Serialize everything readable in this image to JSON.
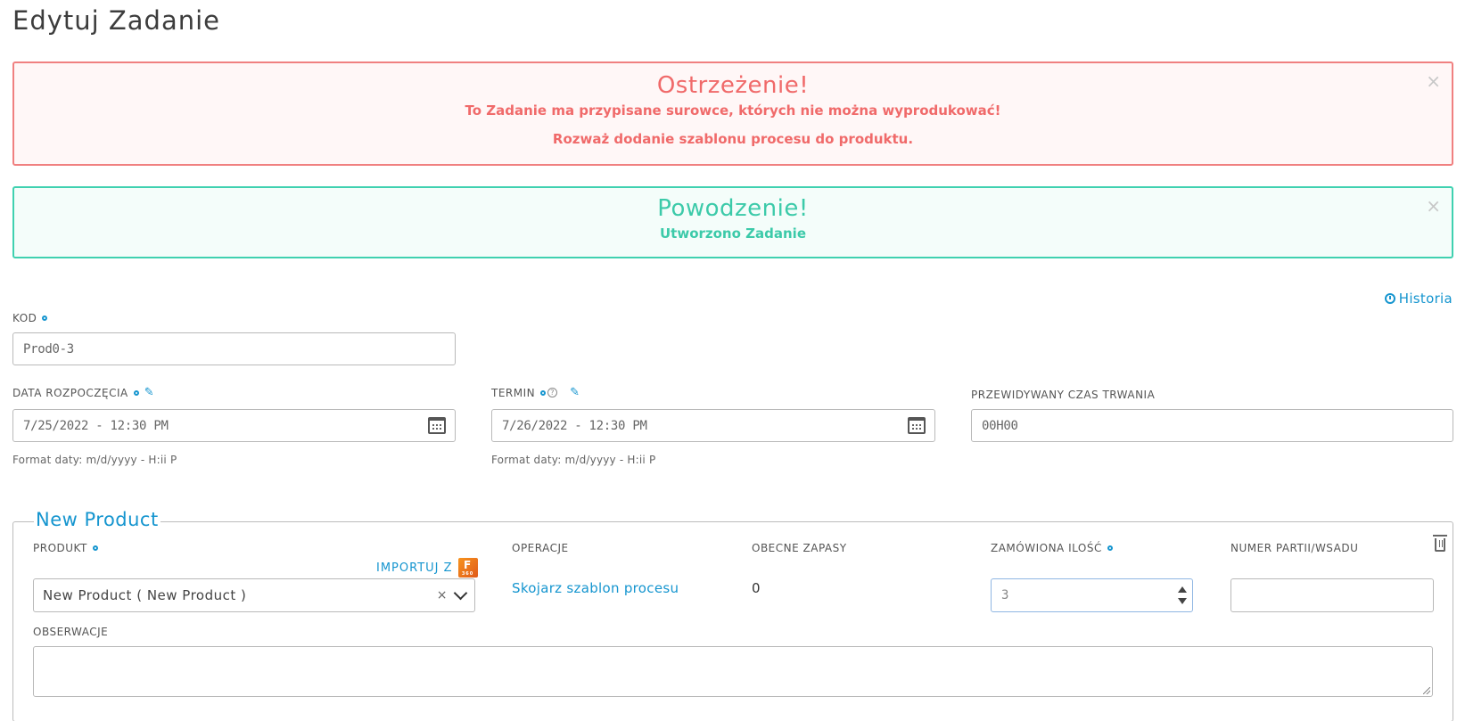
{
  "page": {
    "title": "Edytuj Zadanie"
  },
  "alerts": {
    "warning": {
      "title": "Ostrzeżenie!",
      "line1": "To Zadanie ma przypisane surowce, których nie można wyprodukować!",
      "line2": "Rozważ dodanie szablonu procesu do produktu.",
      "close": "×"
    },
    "success": {
      "title": "Powodzenie!",
      "line1": "Utworzono Zadanie",
      "close": "×"
    }
  },
  "history": {
    "label": "Historia"
  },
  "form": {
    "kod": {
      "label": "KOD",
      "value": "Prod0-3"
    },
    "start_date": {
      "label": "DATA ROZPOCZĘCIA",
      "value": "7/25/2022 - 12:30 PM",
      "hint": "Format daty: m/d/yyyy - H:ii P"
    },
    "deadline": {
      "label": "TERMIN",
      "value": "7/26/2022 - 12:30 PM",
      "hint": "Format daty: m/d/yyyy - H:ii P",
      "help": "?"
    },
    "duration": {
      "label": "PRZEWIDYWANY CZAS TRWANIA",
      "value": "00H00"
    }
  },
  "product_section": {
    "legend": "New Product",
    "produkt": {
      "label": "PRODUKT",
      "value": "New Product ( New Product )",
      "clear": "×"
    },
    "import": {
      "label": "IMPORTUJ Z",
      "icon_letter": "F"
    },
    "operacje": {
      "label": "OPERACJE",
      "link": "Skojarz szablon procesu"
    },
    "zapasy": {
      "label": "OBECNE ZAPASY",
      "value": "0"
    },
    "ilosc": {
      "label": "ZAMÓWIONA ILOŚĆ",
      "value": "3"
    },
    "partia": {
      "label": "NUMER PARTII/WSADU",
      "value": ""
    },
    "obserwacje": {
      "label": "OBSERWACJE",
      "value": ""
    }
  },
  "colors": {
    "accent": "#1595cf",
    "warning": "#f06a6a",
    "success": "#3ccaa9"
  }
}
